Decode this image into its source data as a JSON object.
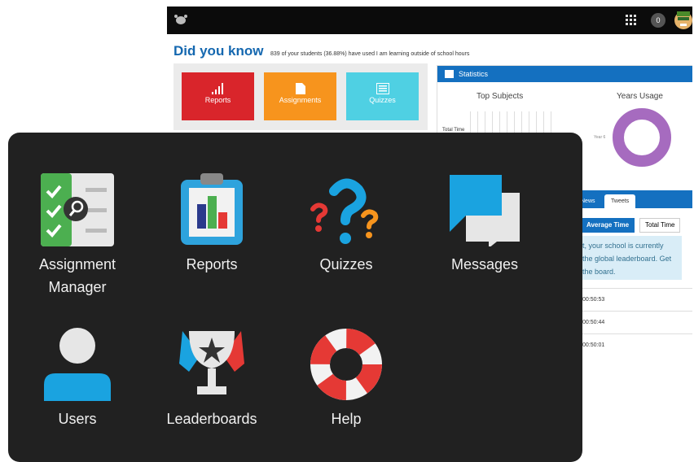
{
  "topbar": {
    "notification_count": "0",
    "icons": [
      "logo-icon",
      "apps-grid-icon",
      "avatar-icon"
    ]
  },
  "did_you_know": {
    "heading": "Did you know",
    "text": "839 of your students (36.88%) have used I am learning outside of school hours"
  },
  "quick_tiles": [
    {
      "label": "Reports",
      "color": "#d9252b"
    },
    {
      "label": "Assignments",
      "color": "#f7941d"
    },
    {
      "label": "Quizzes",
      "color": "#4fd0e3"
    }
  ],
  "statistics": {
    "title": "Statistics",
    "top_subjects": "Top Subjects",
    "years_usage": "Years Usage",
    "total_time_label": "Total Time",
    "year_label": "Year 6"
  },
  "leaderboard": {
    "tabs": [
      "News",
      "Tweets"
    ],
    "buttons": [
      "Average Time",
      "Total Time"
    ],
    "info_lines": [
      "t, your school is currently",
      "the global leaderboard. Get",
      "the board."
    ],
    "rows": [
      "00:50:53",
      "00:50:44",
      "00:50:01"
    ]
  },
  "apps": [
    {
      "line1": "Assignment",
      "line2": "Manager"
    },
    {
      "line1": "Reports",
      "line2": ""
    },
    {
      "line1": "Quizzes",
      "line2": ""
    },
    {
      "line1": "Messages",
      "line2": ""
    },
    {
      "line1": "Users",
      "line2": ""
    },
    {
      "line1": "Leaderboards",
      "line2": ""
    },
    {
      "line1": "Help",
      "line2": ""
    }
  ]
}
